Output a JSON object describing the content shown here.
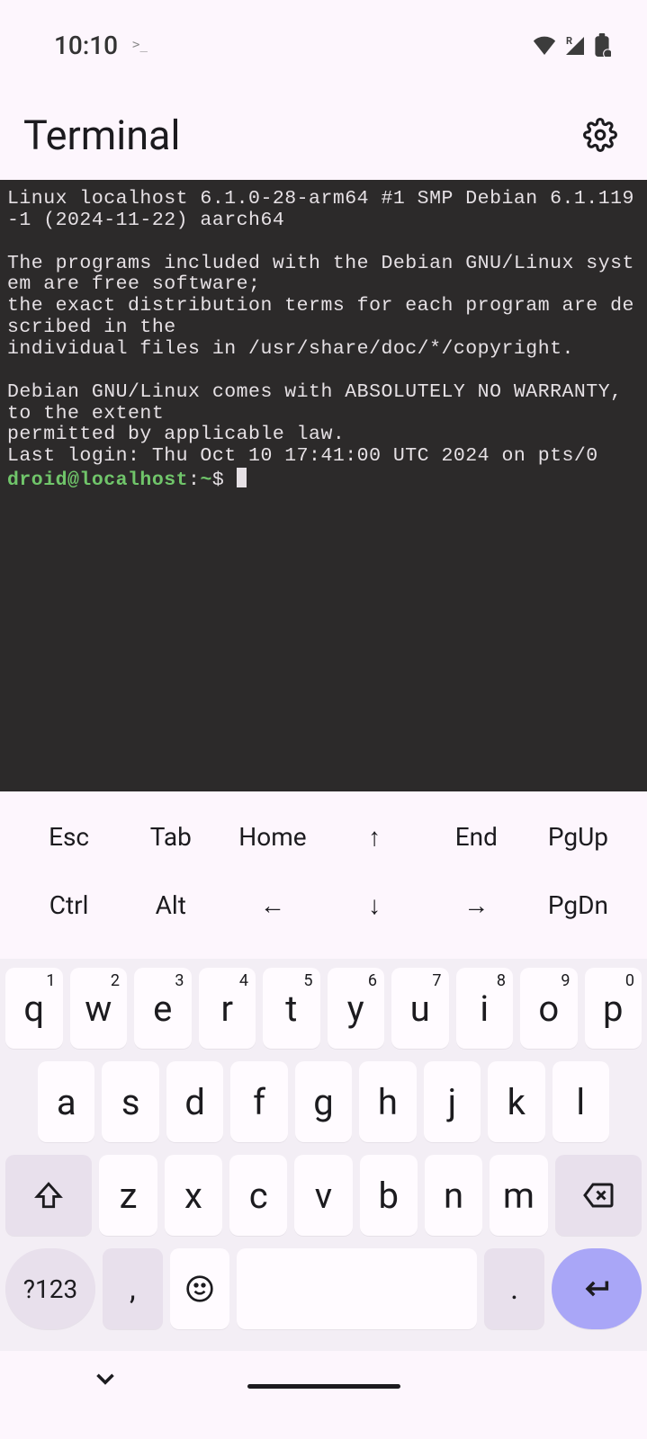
{
  "status": {
    "time": "10:10",
    "network_label": "R"
  },
  "header": {
    "title": "Terminal"
  },
  "terminal": {
    "motd_lines": [
      "Linux localhost 6.1.0-28-arm64 #1 SMP Debian 6.1.119-1 (2024-11-22) aarch64",
      "",
      "The programs included with the Debian GNU/Linux system are free software;",
      "the exact distribution terms for each program are described in the",
      "individual files in /usr/share/doc/*/copyright.",
      "",
      "Debian GNU/Linux comes with ABSOLUTELY NO WARRANTY, to the extent",
      "permitted by applicable law.",
      "Last login: Thu Oct 10 17:41:00 UTC 2024 on pts/0"
    ],
    "prompt": {
      "user": "droid",
      "host": "localhost",
      "path": "~",
      "sigil": "$"
    }
  },
  "extra_keys": {
    "row1": [
      "Esc",
      "Tab",
      "Home",
      "↑",
      "End",
      "PgUp"
    ],
    "row2": [
      "Ctrl",
      "Alt",
      "←",
      "↓",
      "→",
      "PgDn"
    ]
  },
  "keyboard": {
    "row1": [
      {
        "label": "q",
        "sup": "1"
      },
      {
        "label": "w",
        "sup": "2"
      },
      {
        "label": "e",
        "sup": "3"
      },
      {
        "label": "r",
        "sup": "4"
      },
      {
        "label": "t",
        "sup": "5"
      },
      {
        "label": "y",
        "sup": "6"
      },
      {
        "label": "u",
        "sup": "7"
      },
      {
        "label": "i",
        "sup": "8"
      },
      {
        "label": "o",
        "sup": "9"
      },
      {
        "label": "p",
        "sup": "0"
      }
    ],
    "row2": [
      "a",
      "s",
      "d",
      "f",
      "g",
      "h",
      "j",
      "k",
      "l"
    ],
    "row3": [
      "z",
      "x",
      "c",
      "v",
      "b",
      "n",
      "m"
    ],
    "row4": {
      "numbers": "?123",
      "comma": ",",
      "period": "."
    }
  }
}
